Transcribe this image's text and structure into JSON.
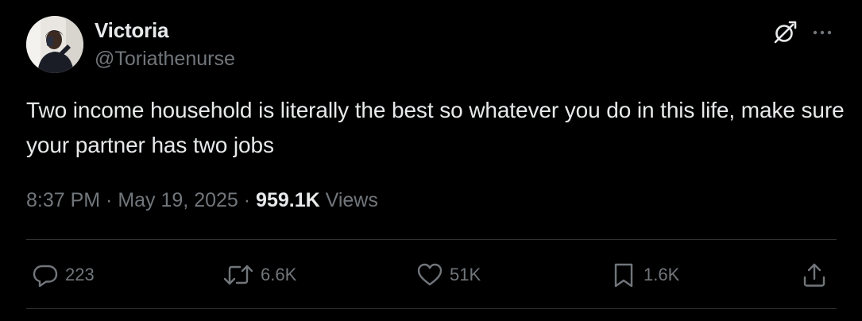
{
  "user": {
    "display_name": "Victoria",
    "handle": "@Toriathenurse",
    "avatar_icon": "profile-photo"
  },
  "header_actions": {
    "grok_icon": "grok-icon",
    "more_icon": "more-horizontal-icon"
  },
  "tweet": {
    "text": "Two income household is literally the best so whatever you do in this life, make sure your partner has two jobs"
  },
  "meta": {
    "time": "8:37 PM",
    "separator1": " · ",
    "date": "May 19, 2025",
    "separator2": " · ",
    "views_count": "959.1K",
    "views_label": " Views"
  },
  "actions": {
    "reply": {
      "icon": "reply-icon",
      "count": "223"
    },
    "retweet": {
      "icon": "retweet-icon",
      "count": "6.6K"
    },
    "like": {
      "icon": "heart-icon",
      "count": "51K"
    },
    "bookmark": {
      "icon": "bookmark-icon",
      "count": "1.6K"
    },
    "share": {
      "icon": "share-icon"
    }
  },
  "colors": {
    "background": "#000000",
    "primary_text": "#e7e9ea",
    "secondary_text": "#71767b",
    "divider": "#2f3336"
  }
}
